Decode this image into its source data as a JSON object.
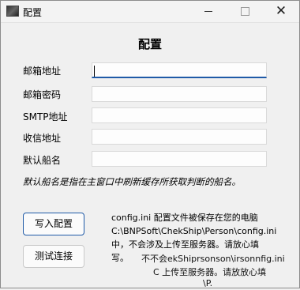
{
  "window": {
    "title": "配置",
    "close_glyph": "✕"
  },
  "form": {
    "heading": "配置",
    "fields": [
      {
        "label": "邮箱地址",
        "value": ""
      },
      {
        "label": "邮箱密码",
        "value": ""
      },
      {
        "label": "SMTP地址",
        "value": ""
      },
      {
        "label": "收信地址",
        "value": ""
      },
      {
        "label": "默认船名",
        "value": ""
      }
    ],
    "note": "默认船名是指在主窗口中刷新缓存所获取判断的船名。"
  },
  "actions": {
    "write_label": "写入配置",
    "test_label": "测试连接"
  },
  "info": {
    "line1": "config.ini 配置文件被保存在您的电脑",
    "line2": "C:\\BNPSoft\\ChekShip\\Person\\config.ini",
    "line3": "中，不会涉及上传至服务器。请放心填",
    "line4": "写。",
    "ghost1": "不不会ekShiprsonson\\irsonnfig.ini",
    "ghost2": "C 上传至服务器。请放放心填",
    "ghost3": "\\P."
  },
  "icons": {
    "app": "app-icon",
    "minimize": "minimize-icon",
    "maximize": "maximize-icon",
    "close": "close-icon"
  },
  "colors": {
    "accent": "#1f5aa7",
    "window_bg": "#f0f0f0"
  }
}
